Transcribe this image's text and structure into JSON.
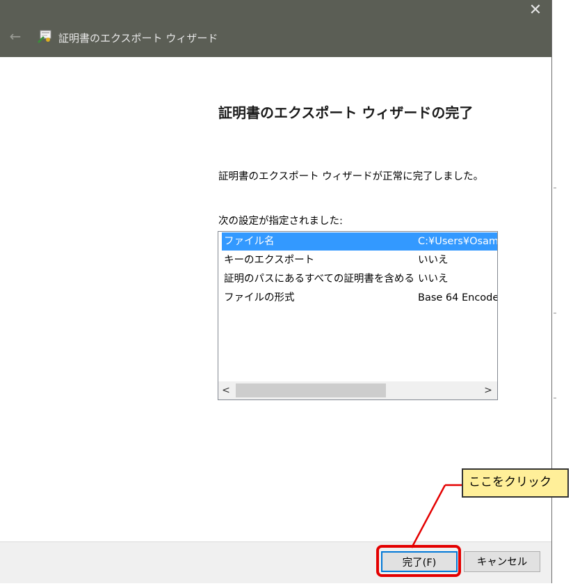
{
  "window": {
    "title": "証明書のエクスポート ウィザード",
    "close_glyph": "✕",
    "back_glyph": "←"
  },
  "content": {
    "heading": "証明書のエクスポート ウィザードの完了",
    "message": "証明書のエクスポート ウィザードが正常に完了しました。",
    "settings_label": "次の設定が指定されました:"
  },
  "settings_list": {
    "rows": [
      {
        "key": "ファイル名",
        "value": "C:¥Users¥Osam"
      },
      {
        "key": "キーのエクスポート",
        "value": "いいえ"
      },
      {
        "key": "証明のパスにあるすべての証明書を含める",
        "value": "いいえ"
      },
      {
        "key": "ファイルの形式",
        "value": "Base 64 Encode"
      }
    ],
    "selected_index": 0,
    "scroll_left_glyph": "<",
    "scroll_right_glyph": ">"
  },
  "buttons": {
    "finish": "完了(F)",
    "cancel": "キャンセル"
  },
  "annotation": {
    "callout_text": "ここをクリック"
  },
  "colors": {
    "titlebar": "#5b5e55",
    "selection": "#3399ff",
    "callout_bg": "#ffef99",
    "highlight": "#e40000"
  }
}
